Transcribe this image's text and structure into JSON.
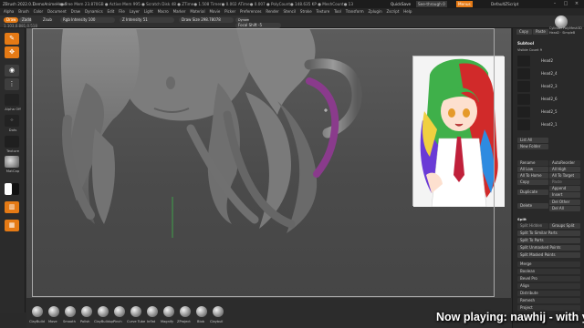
{
  "titlebar": {
    "app": "ZBrush 2022.0.1",
    "project": "DemoAnimeHead",
    "stats": "● Free Mem 23.870GB ● Active Mem 995 ● Scratch Disk 48 ● ZTime● 1.508 Timer● 0.002 ATime● 0.007 ● PolyCount● 148.635 KP ● MeshCount● 13",
    "quicksave": "QuickSave",
    "see_through": "See-through 0",
    "menus": "Menus",
    "script": "DefaultZScript"
  },
  "menubar": [
    "Alpha",
    "Brush",
    "Color",
    "Document",
    "Draw",
    "Dynamics",
    "Edit",
    "File",
    "Layer",
    "Light",
    "Macro",
    "Marker",
    "Material",
    "Movie",
    "Picker",
    "Preferences",
    "Render",
    "Stencil",
    "Stroke",
    "Texture",
    "Tool",
    "Transform",
    "Zplugin",
    "Zscript",
    "Help"
  ],
  "toolrow": {
    "coords": "1.103,0.881,0.518",
    "mode_draw": "Draw",
    "mode_zadd": "Zadd",
    "mode_zsub": "Zsub",
    "rgb_label": "Rgb Intensity 100",
    "z_label": "Z Intensity 51",
    "drawsize_label": "Draw Size 298.78078",
    "focal_label": "Focal Shift -5",
    "dynamic": "Dynamic"
  },
  "leftshelf": {
    "alpha_label": "Alpha Off",
    "dots_label": "Dots",
    "texture_label": "Texture",
    "matcap_label": "MatCap"
  },
  "rightpanel": {
    "copy_label": "Copy",
    "paste_label": "Paste",
    "cylinder_label": "Cylinder PolyMesh3D",
    "head_label": "Head2 · SimpleB",
    "subtool_title": "Subtool",
    "visible_count": "Visible Count 9",
    "subtools": [
      "Head2",
      "Head2_4",
      "Head2_3",
      "Head2_6",
      "Head2_5",
      "Head2_1"
    ],
    "buttons": {
      "list_all": "List All",
      "new_folder": "New Folder",
      "rename": "Rename",
      "autoreorder": "AutoReorder",
      "all_low": "All Low",
      "all_high": "All High",
      "all_to_home": "All To Home",
      "all_to_target": "All To Target",
      "copy": "Copy",
      "paste": "Paste",
      "duplicate": "Duplicate",
      "append": "Append",
      "insert": "Insert",
      "delete": "Delete",
      "del_other": "Del Other",
      "del_all": "Del All",
      "split_section": "Split",
      "split_hidden": "Split Hidden",
      "groups_split": "Groups Split",
      "split_to_similar": "Split To Similar Parts",
      "split_to_parts": "Split To Parts",
      "split_unmasked": "Split Unmasked Points",
      "split_masked": "Split Masked Points",
      "merge": "Merge",
      "boolean": "Boolean",
      "bevel_pro": "Bevel Pro",
      "align": "Align",
      "distribute": "Distribute",
      "remesh": "Remesh",
      "project": "Project"
    }
  },
  "brushes": [
    "ClayBuild",
    "Move",
    "Smooth",
    "Polish",
    "ClayBuildup",
    "Pinch",
    "Curve Tube",
    "Inflat",
    "Magnify",
    "ZProject",
    "Blob",
    "Claybuil"
  ],
  "overlay": {
    "now_playing": "Now playing: nawhij - with you"
  },
  "colors": {
    "accent": "#e57a15",
    "panel": "#292929",
    "viewport": "#525252",
    "hair_purple": "#8a3b8c"
  }
}
